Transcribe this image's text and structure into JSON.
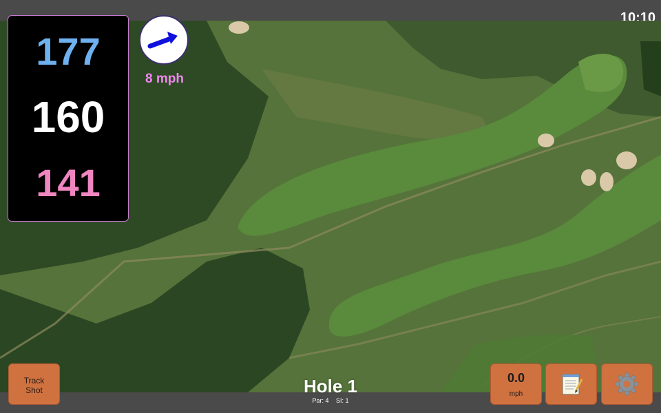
{
  "status": {
    "time": "10:10"
  },
  "distances": {
    "back": "177",
    "middle": "160",
    "front": "141"
  },
  "wind": {
    "speed": "8 mph",
    "icon": "wind-direction-arrow-icon"
  },
  "hole": {
    "title": "Hole 1",
    "par": "Par: 4",
    "stroke_index": "SI: 1"
  },
  "buttons": {
    "track_line1": "Track",
    "track_line2": "Shot",
    "speed_value": "0.0",
    "speed_unit": "mph",
    "notes_icon": "notepad-icon",
    "settings_icon": "gear-icon"
  },
  "colors": {
    "back": "#6fb1f0",
    "middle": "#ffffff",
    "front": "#ef86c0",
    "wind_text": "#ef86ef",
    "button": "#cf7240"
  }
}
